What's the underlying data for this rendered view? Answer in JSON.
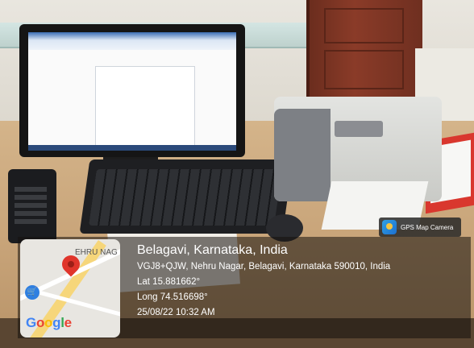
{
  "badge": {
    "label": "GPS Map Camera",
    "icon": "gps-map-camera-icon"
  },
  "map": {
    "area_label": "EHRU NAG",
    "logo": {
      "g1": "G",
      "o1": "o",
      "o2": "o",
      "g2": "g",
      "l": "l",
      "e": "e"
    },
    "pin_icon": "map-pin-icon",
    "shop_icon": "shopping-cart-icon"
  },
  "location": {
    "title": "Belagavi, Karnataka, India",
    "address": "VGJ8+QJW, Nehru Nagar, Belagavi, Karnataka 590010, India",
    "lat": "Lat 15.881662°",
    "long": "Long 74.516698°",
    "datetime": "25/08/22 10:32 AM"
  },
  "colors": {
    "pin": "#e0352b",
    "overlay": "rgba(20,16,12,0.55)",
    "road": "#f6d67a"
  }
}
